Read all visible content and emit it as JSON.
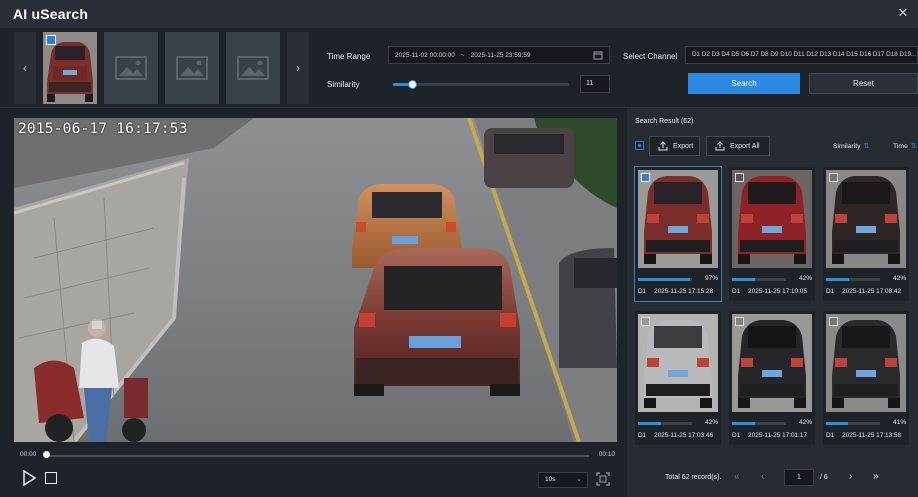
{
  "app": {
    "title": "AI uSearch",
    "close_glyph": "✕"
  },
  "thumb_strip": {
    "prev_glyph": "‹",
    "next_glyph": "›",
    "items": [
      {
        "state": "selected-capture"
      },
      {
        "state": "placeholder"
      },
      {
        "state": "placeholder"
      },
      {
        "state": "placeholder"
      }
    ]
  },
  "filters": {
    "time_range_label": "Time Range",
    "time_start": "2025-11-02 00:00:00",
    "time_sep": "~",
    "time_end": "2025-11-25 23:59:59",
    "similarity_label": "Similarity",
    "similarity_value": "11",
    "similarity_fraction": 0.11,
    "channel_label": "Select Channel",
    "channel_value": "D1 D2 D3 D4 D5 D6 D7 D8 D9 D10 D11 D12 D13 D14 D15 D16 D17 D18 D19...",
    "search_label": "Search",
    "reset_label": "Reset"
  },
  "player": {
    "osd_timestamp": "2015-06-17 16:17:53",
    "time_start": "00:00",
    "time_end": "00:10",
    "progress_fraction": 0.0,
    "speed": "10s",
    "speed_chevron": "⌄"
  },
  "results": {
    "title": "Search Result  (62)",
    "export_label": "Export",
    "export_all_label": "Export All",
    "sort_similarity": "Similarity",
    "sort_time": "Time",
    "sort_arrow": "⇅",
    "cards": [
      {
        "channel": "D1",
        "time": "2025-11-25 17:15:28",
        "pct": "97%",
        "fraction": 0.97,
        "checked": true,
        "car": "maroon-suv"
      },
      {
        "channel": "D1",
        "time": "2025-11-25 17:10:05",
        "pct": "42%",
        "fraction": 0.42,
        "checked": false,
        "car": "red-suv"
      },
      {
        "channel": "D1",
        "time": "2025-11-25 17:08:42",
        "pct": "42%",
        "fraction": 0.42,
        "checked": false,
        "car": "dark-suv"
      },
      {
        "channel": "D1",
        "time": "2025-11-25 17:03:46",
        "pct": "42%",
        "fraction": 0.42,
        "checked": false,
        "car": "silver-sedan"
      },
      {
        "channel": "D1",
        "time": "2025-11-25 17:01:17",
        "pct": "42%",
        "fraction": 0.42,
        "checked": false,
        "car": "black-suv"
      },
      {
        "channel": "D1",
        "time": "2025-11-25 17:13:58",
        "pct": "41%",
        "fraction": 0.41,
        "checked": false,
        "car": "black-sedan"
      }
    ],
    "total_text": "Total 62 record(s).",
    "first_glyph": "«",
    "prev_glyph": "‹",
    "page": "1",
    "of_pages": "/ 6",
    "next_glyph": "›",
    "last_glyph": "»"
  },
  "colors": {
    "accent": "#2a89df",
    "panel": "#272c33",
    "background": "#1e2229"
  }
}
